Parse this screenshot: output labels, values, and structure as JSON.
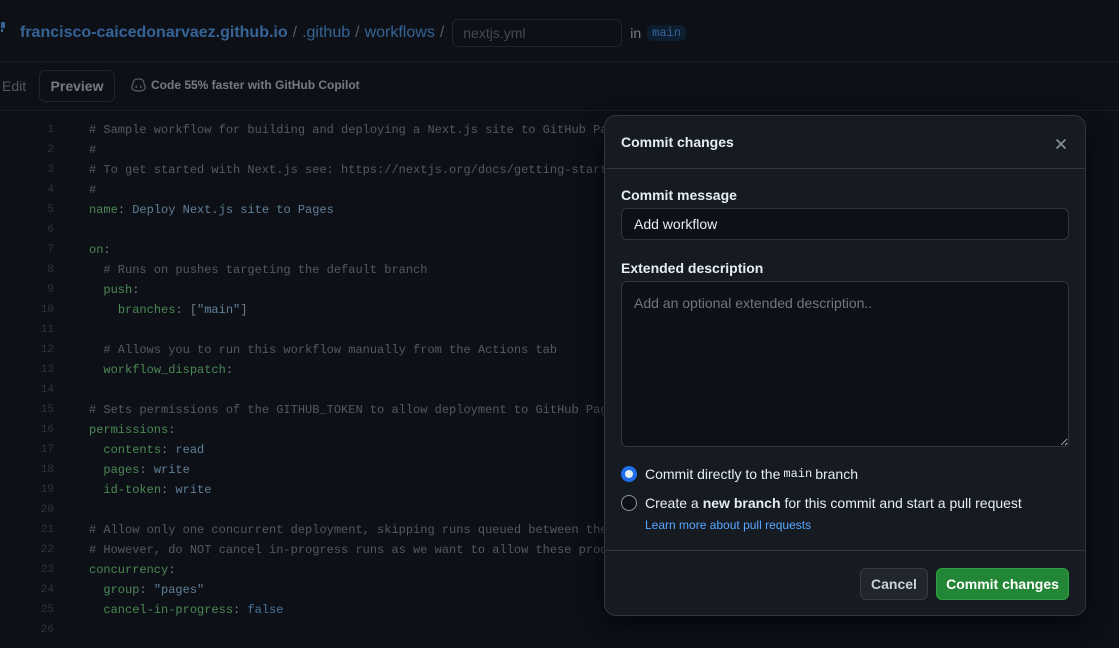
{
  "breadcrumb": {
    "owner": "francisco-caicedonarvaez.github.io",
    "sep": "/",
    "dir1": ".github",
    "dir2": "workflows",
    "filename_placeholder": "nextjs.yml",
    "in_text": "in",
    "branch": "main"
  },
  "toolbar": {
    "edit": "Edit",
    "preview": "Preview",
    "copilot": "Code 55% faster with GitHub Copilot"
  },
  "code_lines": [
    {
      "n": "1",
      "parts": [
        [
          "com",
          "# Sample workflow for building and deploying a Next.js site to GitHub Pages"
        ]
      ]
    },
    {
      "n": "2",
      "parts": [
        [
          "com",
          "#"
        ]
      ]
    },
    {
      "n": "3",
      "parts": [
        [
          "com",
          "# To get started with Next.js see: https://nextjs.org/docs/getting-started"
        ]
      ]
    },
    {
      "n": "4",
      "parts": [
        [
          "com",
          "#"
        ]
      ]
    },
    {
      "n": "5",
      "parts": [
        [
          "key",
          "name"
        ],
        [
          "plain",
          ": "
        ],
        [
          "str",
          "Deploy Next.js site to Pages"
        ]
      ]
    },
    {
      "n": "6",
      "parts": []
    },
    {
      "n": "7",
      "parts": [
        [
          "key",
          "on"
        ],
        [
          "plain",
          ":"
        ]
      ]
    },
    {
      "n": "8",
      "parts": [
        [
          "com",
          "  # Runs on pushes targeting the default branch"
        ]
      ]
    },
    {
      "n": "9",
      "parts": [
        [
          "plain",
          "  "
        ],
        [
          "key",
          "push"
        ],
        [
          "plain",
          ":"
        ]
      ]
    },
    {
      "n": "10",
      "parts": [
        [
          "plain",
          "    "
        ],
        [
          "key",
          "branches"
        ],
        [
          "plain",
          ": ["
        ],
        [
          "str",
          "\"main\""
        ],
        [
          "plain",
          "]"
        ]
      ]
    },
    {
      "n": "11",
      "parts": []
    },
    {
      "n": "12",
      "parts": [
        [
          "com",
          "  # Allows you to run this workflow manually from the Actions tab"
        ]
      ]
    },
    {
      "n": "13",
      "parts": [
        [
          "plain",
          "  "
        ],
        [
          "key",
          "workflow_dispatch"
        ],
        [
          "plain",
          ":"
        ]
      ]
    },
    {
      "n": "14",
      "parts": []
    },
    {
      "n": "15",
      "parts": [
        [
          "com",
          "# Sets permissions of the GITHUB_TOKEN to allow deployment to GitHub Pages"
        ]
      ]
    },
    {
      "n": "16",
      "parts": [
        [
          "key",
          "permissions"
        ],
        [
          "plain",
          ":"
        ]
      ]
    },
    {
      "n": "17",
      "parts": [
        [
          "plain",
          "  "
        ],
        [
          "key",
          "contents"
        ],
        [
          "plain",
          ": "
        ],
        [
          "str",
          "read"
        ]
      ]
    },
    {
      "n": "18",
      "parts": [
        [
          "plain",
          "  "
        ],
        [
          "key",
          "pages"
        ],
        [
          "plain",
          ": "
        ],
        [
          "str",
          "write"
        ]
      ]
    },
    {
      "n": "19",
      "parts": [
        [
          "plain",
          "  "
        ],
        [
          "key",
          "id-token"
        ],
        [
          "plain",
          ": "
        ],
        [
          "str",
          "write"
        ]
      ]
    },
    {
      "n": "20",
      "parts": []
    },
    {
      "n": "21",
      "parts": [
        [
          "com",
          "# Allow only one concurrent deployment, skipping runs queued between the run i"
        ]
      ]
    },
    {
      "n": "22",
      "parts": [
        [
          "com",
          "# However, do NOT cancel in-progress runs as we want to allow these production"
        ]
      ]
    },
    {
      "n": "23",
      "parts": [
        [
          "key",
          "concurrency"
        ],
        [
          "plain",
          ":"
        ]
      ]
    },
    {
      "n": "24",
      "parts": [
        [
          "plain",
          "  "
        ],
        [
          "key",
          "group"
        ],
        [
          "plain",
          ": "
        ],
        [
          "str",
          "\"pages\""
        ]
      ]
    },
    {
      "n": "25",
      "parts": [
        [
          "plain",
          "  "
        ],
        [
          "key",
          "cancel-in-progress"
        ],
        [
          "plain",
          ": "
        ],
        [
          "kw",
          "false"
        ]
      ]
    },
    {
      "n": "26",
      "parts": []
    }
  ],
  "dialog": {
    "title": "Commit changes",
    "message_label": "Commit message",
    "message_value": "Add workflow",
    "description_label": "Extended description",
    "description_placeholder": "Add an optional extended description..",
    "option_direct": {
      "before": "Commit directly to the",
      "branch": "main",
      "after": "branch"
    },
    "option_new": {
      "before": "Create a",
      "bold": "new branch",
      "after": "for this commit and start a pull request"
    },
    "learn_more": "Learn more about pull requests",
    "cancel": "Cancel",
    "commit": "Commit changes"
  }
}
